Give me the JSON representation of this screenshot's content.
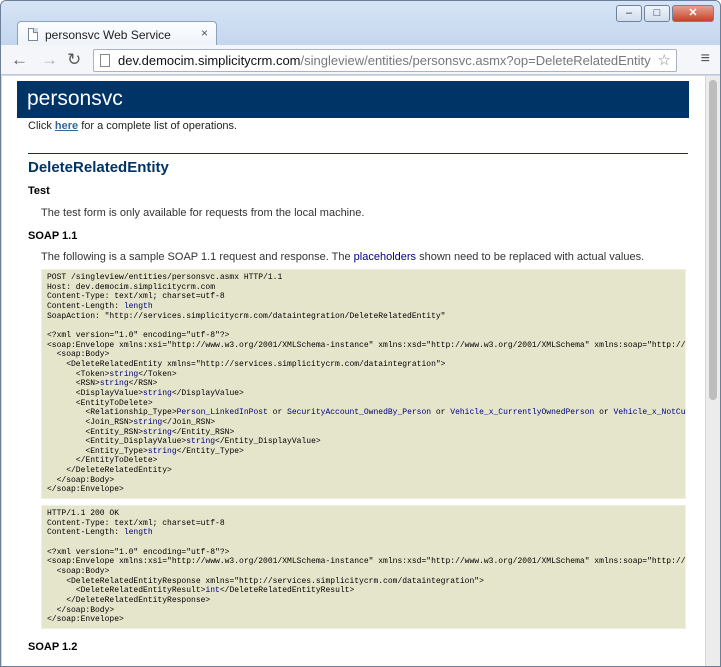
{
  "browser": {
    "tab_title": "personsvc Web Service",
    "tab_close": "×",
    "url_host": "dev.democim.simplicitycrm.com",
    "url_path": "/singleview/entities/personsvc.asmx?op=DeleteRelatedEntity",
    "window_controls": {
      "minimize": "–",
      "maximize": "□",
      "close": "✕"
    },
    "nav": {
      "back": "←",
      "forward": "→",
      "reload": "↻",
      "star": "☆",
      "menu": "≡"
    }
  },
  "page": {
    "service_name": "personsvc",
    "intro_prefix": "Click ",
    "intro_link": "here",
    "intro_suffix": " for a complete list of operations.",
    "operation": "DeleteRelatedEntity",
    "test_heading": "Test",
    "test_text": "The test form is only available for requests from the local machine.",
    "soap11_heading": "SOAP 1.1",
    "soap11_text_prefix": "The following is a sample SOAP 1.1 request and response. The ",
    "soap11_placeholder_word": "placeholders",
    "soap11_text_suffix": " shown need to be replaced with actual values.",
    "soap12_heading": "SOAP 1.2"
  },
  "request_sample": {
    "l1": "POST /singleview/entities/personsvc.asmx HTTP/1.1",
    "l2": "Host: dev.democim.simplicitycrm.com",
    "l3": "Content-Type: text/xml; charset=utf-8",
    "l4_prefix": "Content-Length: ",
    "l4_ph": "length",
    "l5": "SoapAction: \"http://services.simplicitycrm.com/dataintegration/DeleteRelatedEntity\"",
    "l6": "<?xml version=\"1.0\" encoding=\"utf-8\"?>",
    "l7": "<soap:Envelope xmlns:xsi=\"http://www.w3.org/2001/XMLSchema-instance\" xmlns:xsd=\"http://www.w3.org/2001/XMLSchema\" xmlns:soap=\"http://schemas.xmlsoap.org/soap/envelope/\">",
    "l8": "  <soap:Body>",
    "l9": "    <DeleteRelatedEntity xmlns=\"http://services.simplicitycrm.com/dataintegration\">",
    "l10_open": "      <Token>",
    "l10_ph": "string",
    "l10_close": "</Token>",
    "l11_open": "      <RSN>",
    "l11_ph": "string",
    "l11_close": "</RSN>",
    "l12_open": "      <DisplayValue>",
    "l12_ph": "string",
    "l12_close": "</DisplayValue>",
    "l13": "      <EntityToDelete>",
    "l14_open": "        <Relationship_Type>",
    "l14_v1": "Person_LinkedInPost",
    "l14_or1": " or ",
    "l14_v2": "SecurityAccount_OwnedBy_Person",
    "l14_or2": " or ",
    "l14_v3": "Vehicle_x_CurrentlyOwnedPerson",
    "l14_or3": " or ",
    "l14_v4": "Vehicle_x_NotCurrentlyOwnedPerson",
    "l15_open": "        <Join_RSN>",
    "l15_ph": "string",
    "l15_close": "</Join_RSN>",
    "l16_open": "        <Entity_RSN>",
    "l16_ph": "string",
    "l16_close": "</Entity_RSN>",
    "l17_open": "        <Entity_DisplayValue>",
    "l17_ph": "string",
    "l17_close": "</Entity_DisplayValue>",
    "l18_open": "        <Entity_Type>",
    "l18_ph": "string",
    "l18_close": "</Entity_Type>",
    "l19": "      </EntityToDelete>",
    "l20": "    </DeleteRelatedEntity>",
    "l21": "  </soap:Body>",
    "l22": "</soap:Envelope>"
  },
  "response_sample": {
    "l1": "HTTP/1.1 200 OK",
    "l2": "Content-Type: text/xml; charset=utf-8",
    "l3_prefix": "Content-Length: ",
    "l3_ph": "length",
    "l4": "<?xml version=\"1.0\" encoding=\"utf-8\"?>",
    "l5": "<soap:Envelope xmlns:xsi=\"http://www.w3.org/2001/XMLSchema-instance\" xmlns:xsd=\"http://www.w3.org/2001/XMLSchema\" xmlns:soap=\"http://schemas.xmlsoap.org/soap/envelope/\">",
    "l6": "  <soap:Body>",
    "l7": "    <DeleteRelatedEntityResponse xmlns=\"http://services.simplicitycrm.com/dataintegration\">",
    "l8_open": "      <DeleteRelatedEntityResult>",
    "l8_ph": "int",
    "l8_close": "</DeleteRelatedEntityResult>",
    "l9": "    </DeleteRelatedEntityResponse>",
    "l10": "  </soap:Body>",
    "l11": "</soap:Envelope>"
  },
  "colors": {
    "heading_band": "#003366",
    "code_background": "#e5e5cc",
    "link": "#336699",
    "placeholder": "#000080"
  }
}
